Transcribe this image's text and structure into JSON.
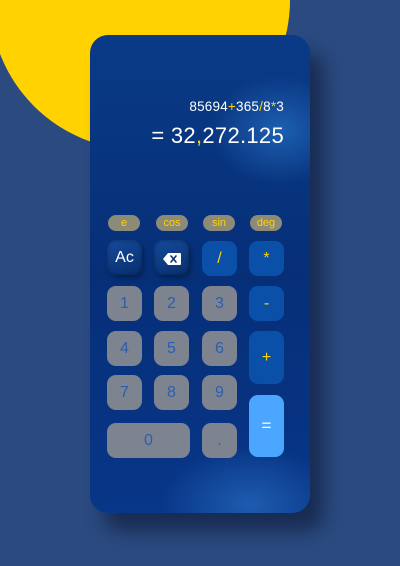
{
  "display": {
    "expression": [
      {
        "text": "85694",
        "kind": "num"
      },
      {
        "text": "+",
        "kind": "op"
      },
      {
        "text": "365",
        "kind": "num"
      },
      {
        "text": "/",
        "kind": "op"
      },
      {
        "text": "8",
        "kind": "num"
      },
      {
        "text": "*",
        "kind": "op"
      },
      {
        "text": "3",
        "kind": "num"
      }
    ],
    "result_prefix": "= 32",
    "result_sep": ",",
    "result_suffix": "272.125"
  },
  "sci": {
    "e": "e",
    "cos": "cos",
    "sin": "sin",
    "deg": "deg"
  },
  "keys": {
    "ac": "Ac",
    "divide": "/",
    "multiply": "*",
    "minus": "-",
    "plus": "+",
    "equals": "=",
    "one": "1",
    "two": "2",
    "three": "3",
    "four": "4",
    "five": "5",
    "six": "6",
    "seven": "7",
    "eight": "8",
    "nine": "9",
    "zero": "0",
    "dot": "."
  },
  "icons": {
    "backspace": "backspace-icon"
  },
  "colors": {
    "background": "#2b4a80",
    "accent_yellow": "#ffd200",
    "body": "#073380",
    "number_key": "#7d8490",
    "operator_key": "#0a4fa8",
    "equals_key": "#4aa6ff"
  }
}
